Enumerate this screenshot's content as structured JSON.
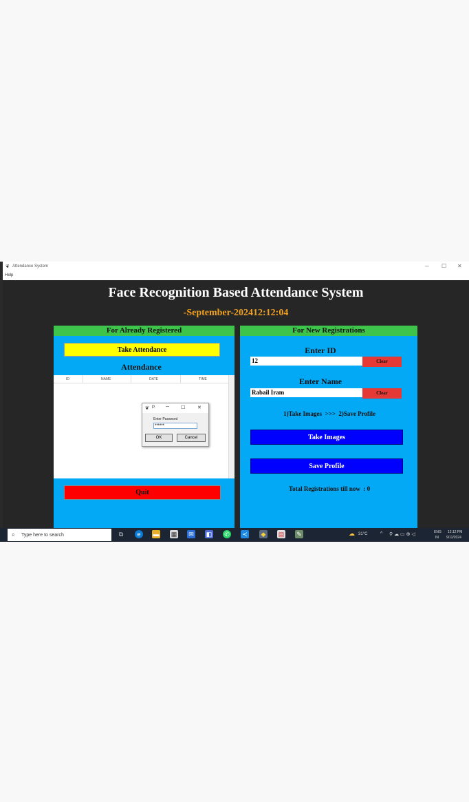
{
  "window": {
    "title": "Attendance System",
    "menu": "Help"
  },
  "app": {
    "title": "Face Recognition Based Attendance System",
    "datetime": "-September-202412:12:04",
    "left_panel": {
      "header": "For Already Registered",
      "take_attendance_label": "Take Attendance",
      "attendance_heading": "Attendance",
      "columns": [
        "ID",
        "NAME",
        "DATE",
        "TIME"
      ],
      "quit_label": "Quit"
    },
    "right_panel": {
      "header": "For New Registrations",
      "enter_id_label": "Enter ID",
      "id_value": "12",
      "clear_label": "Clear",
      "enter_name_label": "Enter Name",
      "name_value": "Rabail Iram",
      "steps_text": "1)Take Images  >>>  2)Save Profile",
      "take_images_label": "Take Images",
      "save_profile_label": "Save Profile",
      "total_text": "Total Registrations till now  : 0"
    }
  },
  "dialog": {
    "title": "P.",
    "prompt": "Enter Password",
    "value": "******",
    "ok_label": "OK",
    "cancel_label": "Cancel"
  },
  "taskbar": {
    "search_placeholder": "Type here to search",
    "weather": "31°C",
    "lang": "ENG",
    "region": "IN",
    "time": "12:12 PM",
    "date": "9/11/2024"
  },
  "colors": {
    "app_bg": "#262626",
    "panel_blue": "#03a9f4",
    "header_green": "#3ec44a",
    "yellow_button": "#ffff00",
    "red_button": "#ff0000",
    "blue_button": "#0000ff",
    "clock_orange": "#f0a020"
  }
}
